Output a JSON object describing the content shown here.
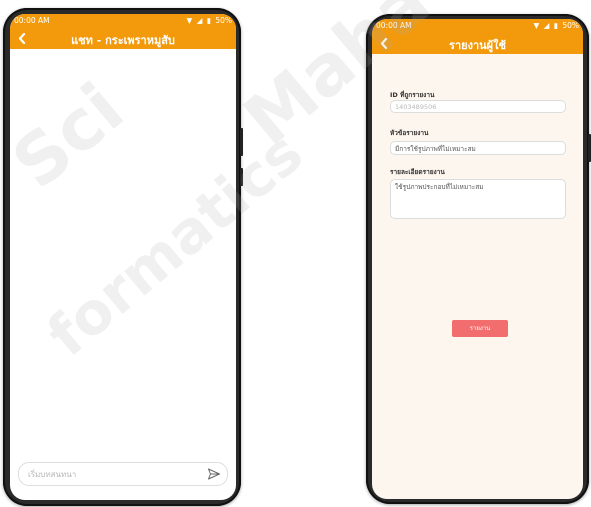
{
  "left_screen": {
    "status": {
      "time": "00:00 AM",
      "battery": "50%"
    },
    "title": "แชท - กระเพราหมูสับ",
    "chat_placeholder": "เริ่มบทสนทนา"
  },
  "right_screen": {
    "status": {
      "time": "00:00 AM",
      "battery": "50%"
    },
    "title": "รายงานผู้ใช้",
    "fields": [
      {
        "label": "ID ที่ถูกรายงาน",
        "value": "1403489506"
      },
      {
        "label": "หัวข้อรายงาน",
        "value": "มีการใช้รูปภาพที่ไม่เหมาะสม"
      },
      {
        "label": "รายละเอียดรายงาน",
        "value": "ใช้รูปภาพประกอบที่ไม่เหมาะสม"
      }
    ],
    "report_button": "รายงาน"
  },
  "watermark": [
    "Sci",
    "Maha",
    "formatics"
  ],
  "colors": {
    "accent": "#f39a0c",
    "report_button": "#f26d6d"
  }
}
